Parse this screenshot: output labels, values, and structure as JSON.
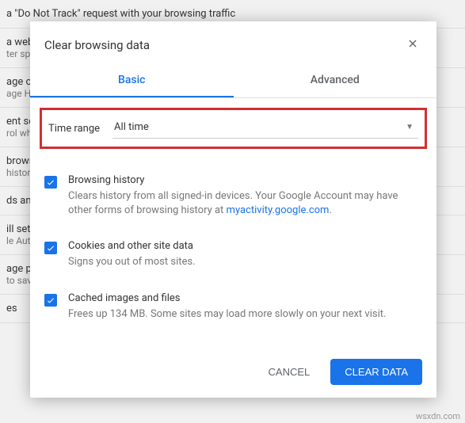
{
  "background": {
    "row1": "a \"Do Not Track\" request with your browsing traffic",
    "row2_title": "a web s",
    "row2_sub": "ter sp",
    "row3_title": "age ce",
    "row3_sub": "age HT",
    "row4_title": "ent set",
    "row4_sub": "rol wh",
    "row5_title": "brows",
    "row5_sub": "histor",
    "row6_title": "ds and",
    "row7_title": "ill sett",
    "row7_sub": "le Aut",
    "row8_title": "age pa",
    "row8_sub": "to sav",
    "row9_title": "es"
  },
  "dialog": {
    "title": "Clear browsing data",
    "tabs": {
      "basic": "Basic",
      "advanced": "Advanced"
    },
    "time_range": {
      "label": "Time range",
      "value": "All time"
    },
    "options": [
      {
        "title": "Browsing history",
        "desc_before": "Clears history from all signed-in devices. Your Google Account may have other forms of browsing history at ",
        "link": "myactivity.google.com",
        "desc_after": "."
      },
      {
        "title": "Cookies and other site data",
        "desc_before": "Signs you out of most sites.",
        "link": "",
        "desc_after": ""
      },
      {
        "title": "Cached images and files",
        "desc_before": "Frees up 134 MB. Some sites may load more slowly on your next visit.",
        "link": "",
        "desc_after": ""
      }
    ],
    "buttons": {
      "cancel": "CANCEL",
      "confirm": "CLEAR DATA"
    }
  },
  "watermark": "wsxdn.com"
}
